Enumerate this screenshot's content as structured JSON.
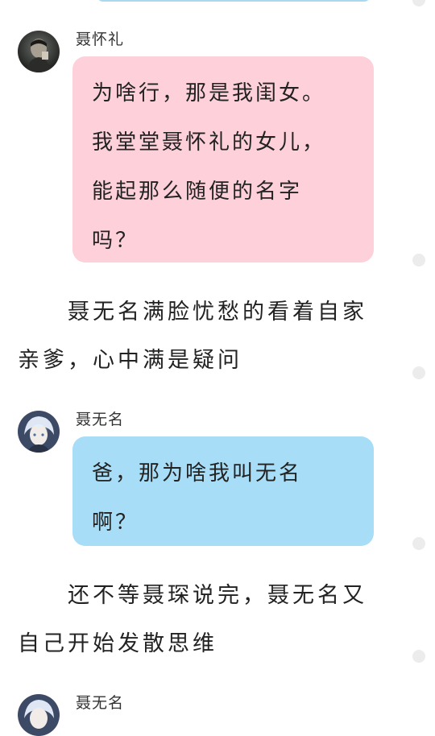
{
  "messages": [
    {
      "speaker": "聂怀礼",
      "bubble_color": "#fdd0da",
      "lines": [
        "为啥行，那是我闺女。",
        "我堂堂聂怀礼的女儿，",
        "能起那么随便的名字",
        "吗？"
      ]
    },
    {
      "speaker": "聂无名",
      "bubble_color": "#a7ddf6",
      "lines": [
        "爸，那为啥我叫无名",
        "啊？"
      ]
    },
    {
      "speaker": "聂无名"
    }
  ],
  "narrations": [
    {
      "lines": [
        "聂无名满脸忧愁的看着自家",
        "亲爹，心中满是疑问"
      ]
    },
    {
      "lines": [
        "还不等聂琛说完，聂无名又",
        "自己开始发散思维"
      ]
    }
  ],
  "icons": {
    "avatar_1": "avatar-man-photo-icon",
    "avatar_2": "avatar-anime-boy-icon",
    "avatar_3": "avatar-anime-boy-icon"
  }
}
